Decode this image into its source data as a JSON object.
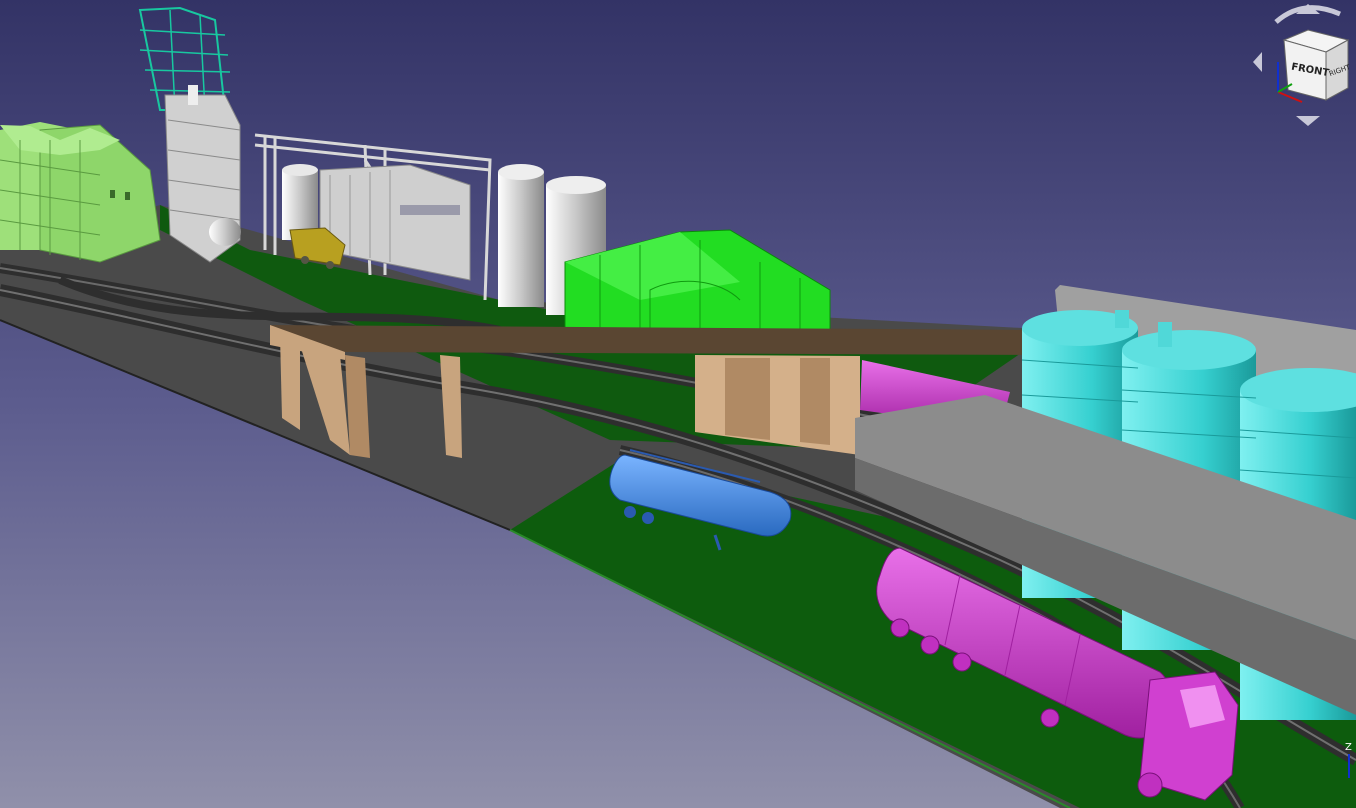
{
  "view": {
    "background_top": "#3a3a6c",
    "background_bottom": "#8a8aa8"
  },
  "navcube": {
    "front_label": "FRONT",
    "right_label": "RIGHT",
    "face_color": "#f2f2f2"
  },
  "axis": {
    "z_label": "Z",
    "x_color": "#d01010",
    "y_color": "#10a010",
    "z_color": "#1030d0"
  },
  "scene_objects": [
    "ground-plane-icon",
    "railway-track-icon",
    "warehouse-building-icon",
    "processing-tower-icon",
    "pipe-rack-icon",
    "storage-silos-icon",
    "green-hall-icon",
    "overhead-conveyor-icon",
    "tank-trailer-icon",
    "magenta-tanker-truck-icon",
    "cyan-storage-tanks-icon",
    "loading-canopy-icon"
  ],
  "colors": {
    "ground_green": "#0b5a0b",
    "track_gray": "#3c3c3c",
    "concrete_gray": "#555555",
    "warehouse_green": "#8ed66a",
    "tower_teal": "#18c8a0",
    "structure_white": "#d8d8d8",
    "hall_green": "#22dd22",
    "conveyor_tan": "#c8a47e",
    "conveyor_top": "#5a4632",
    "trailer_blue": "#4a8fe0",
    "tanker_magenta": "#d040d0",
    "tank_cyan": "#40dada",
    "canopy_gray": "#8c8c8c",
    "yellow_truck": "#b8a020"
  }
}
